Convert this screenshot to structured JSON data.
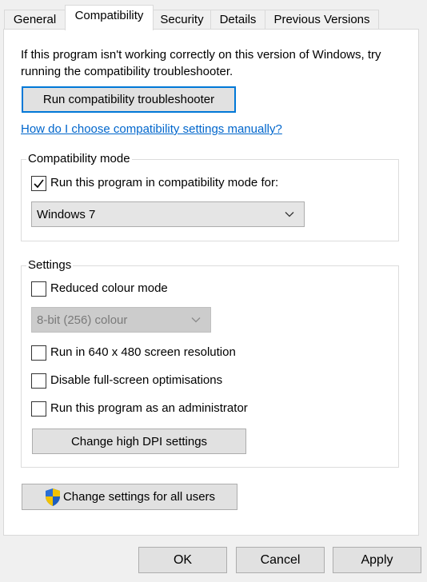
{
  "tabs": [
    {
      "label": "General"
    },
    {
      "label": "Compatibility"
    },
    {
      "label": "Security"
    },
    {
      "label": "Details"
    },
    {
      "label": "Previous Versions"
    }
  ],
  "active_tab": "Compatibility",
  "intro_text": "If this program isn't working correctly on this version of Windows, try running the compatibility troubleshooter.",
  "troubleshooter_button": "Run compatibility troubleshooter",
  "manual_link": "How do I choose compatibility settings manually?",
  "compat_mode": {
    "title": "Compatibility mode",
    "checkbox_label": "Run this program in compatibility mode for:",
    "checked": true,
    "selected_os": "Windows 7"
  },
  "settings": {
    "title": "Settings",
    "reduced_colour": {
      "label": "Reduced colour mode",
      "checked": false
    },
    "colour_select": {
      "value": "8-bit (256) colour",
      "disabled": true
    },
    "res_640": {
      "label": "Run in 640 x 480 screen resolution",
      "checked": false
    },
    "disable_fullscreen": {
      "label": "Disable full-screen optimisations",
      "checked": false
    },
    "run_admin": {
      "label": "Run this program as an administrator",
      "checked": false
    },
    "dpi_button": "Change high DPI settings"
  },
  "all_users_button": "Change settings for all users",
  "buttons": {
    "ok": "OK",
    "cancel": "Cancel",
    "apply": "Apply"
  },
  "colors": {
    "link": "#0066cc",
    "accent": "#0078d7"
  }
}
